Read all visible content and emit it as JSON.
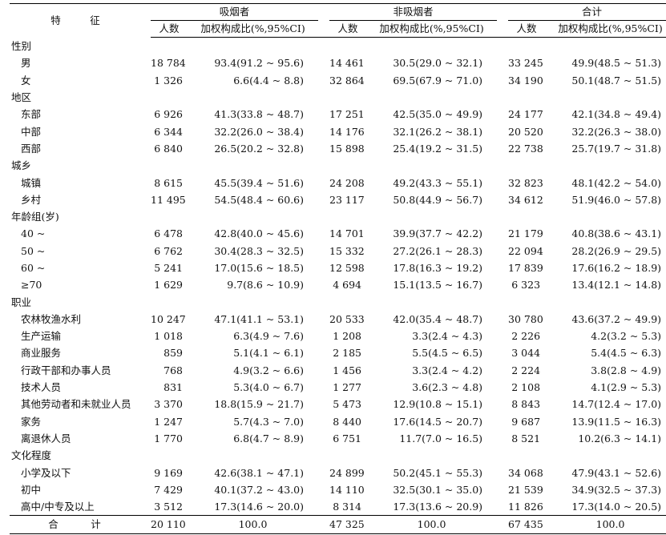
{
  "header": {
    "feature": "特　征",
    "groups": [
      "吸烟者",
      "非吸烟者",
      "合计"
    ],
    "count_label": "人数",
    "pct_label": "加权构成比(%,95%CI)"
  },
  "sections": [
    {
      "name": "性别",
      "rows": [
        {
          "label": "男",
          "s_n": "18 784",
          "s_p": "93.4(91.2 ~ 95.6)",
          "n_n": "14 461",
          "n_p": "30.5(29.0 ~ 32.1)",
          "t_n": "33 245",
          "t_p": "49.9(48.5 ~ 51.3)"
        },
        {
          "label": "女",
          "s_n": "1 326",
          "s_p": "6.6(4.4 ~ 8.8)",
          "n_n": "32 864",
          "n_p": "69.5(67.9 ~ 71.0)",
          "t_n": "34 190",
          "t_p": "50.1(48.7 ~ 51.5)"
        }
      ]
    },
    {
      "name": "地区",
      "rows": [
        {
          "label": "东部",
          "s_n": "6 926",
          "s_p": "41.3(33.8 ~ 48.7)",
          "n_n": "17 251",
          "n_p": "42.5(35.0 ~ 49.9)",
          "t_n": "24 177",
          "t_p": "42.1(34.8 ~ 49.4)"
        },
        {
          "label": "中部",
          "s_n": "6 344",
          "s_p": "32.2(26.0 ~ 38.4)",
          "n_n": "14 176",
          "n_p": "32.1(26.2 ~ 38.1)",
          "t_n": "20 520",
          "t_p": "32.2(26.3 ~ 38.0)"
        },
        {
          "label": "西部",
          "s_n": "6 840",
          "s_p": "26.5(20.2 ~ 32.8)",
          "n_n": "15 898",
          "n_p": "25.4(19.2 ~ 31.5)",
          "t_n": "22 738",
          "t_p": "25.7(19.7 ~ 31.8)"
        }
      ]
    },
    {
      "name": "城乡",
      "rows": [
        {
          "label": "城镇",
          "s_n": "8 615",
          "s_p": "45.5(39.4 ~ 51.6)",
          "n_n": "24 208",
          "n_p": "49.2(43.3 ~ 55.1)",
          "t_n": "32 823",
          "t_p": "48.1(42.2 ~ 54.0)"
        },
        {
          "label": "乡村",
          "s_n": "11 495",
          "s_p": "54.5(48.4 ~ 60.6)",
          "n_n": "23 117",
          "n_p": "50.8(44.9 ~ 56.7)",
          "t_n": "34 612",
          "t_p": "51.9(46.0 ~ 57.8)"
        }
      ]
    },
    {
      "name": "年龄组(岁)",
      "rows": [
        {
          "label": "40 ~",
          "s_n": "6 478",
          "s_p": "42.8(40.0 ~ 45.6)",
          "n_n": "14 701",
          "n_p": "39.9(37.7 ~ 42.2)",
          "t_n": "21 179",
          "t_p": "40.8(38.6 ~ 43.1)"
        },
        {
          "label": "50 ~",
          "s_n": "6 762",
          "s_p": "30.4(28.3 ~ 32.5)",
          "n_n": "15 332",
          "n_p": "27.2(26.1 ~ 28.3)",
          "t_n": "22 094",
          "t_p": "28.2(26.9 ~ 29.5)"
        },
        {
          "label": "60 ~",
          "s_n": "5 241",
          "s_p": "17.0(15.6 ~ 18.5)",
          "n_n": "12 598",
          "n_p": "17.8(16.3 ~ 19.2)",
          "t_n": "17 839",
          "t_p": "17.6(16.2 ~ 18.9)"
        },
        {
          "label": "≥70",
          "s_n": "1 629",
          "s_p": "9.7(8.6 ~ 10.9)",
          "n_n": "4 694",
          "n_p": "15.1(13.5 ~ 16.7)",
          "t_n": "6 323",
          "t_p": "13.4(12.1 ~ 14.8)"
        }
      ]
    },
    {
      "name": "职业",
      "rows": [
        {
          "label": "农林牧渔水利",
          "s_n": "10 247",
          "s_p": "47.1(41.1 ~ 53.1)",
          "n_n": "20 533",
          "n_p": "42.0(35.4 ~ 48.7)",
          "t_n": "30 780",
          "t_p": "43.6(37.2 ~ 49.9)"
        },
        {
          "label": "生产运输",
          "s_n": "1 018",
          "s_p": "6.3(4.9 ~ 7.6)",
          "n_n": "1 208",
          "n_p": "3.3(2.4 ~ 4.3)",
          "t_n": "2 226",
          "t_p": "4.2(3.2 ~ 5.3)"
        },
        {
          "label": "商业服务",
          "s_n": "859",
          "s_p": "5.1(4.1 ~ 6.1)",
          "n_n": "2 185",
          "n_p": "5.5(4.5 ~ 6.5)",
          "t_n": "3 044",
          "t_p": "5.4(4.5 ~ 6.3)"
        },
        {
          "label": "行政干部和办事人员",
          "s_n": "768",
          "s_p": "4.9(3.2 ~ 6.6)",
          "n_n": "1 456",
          "n_p": "3.3(2.4 ~ 4.2)",
          "t_n": "2 224",
          "t_p": "3.8(2.8 ~ 4.9)"
        },
        {
          "label": "技术人员",
          "s_n": "831",
          "s_p": "5.3(4.0 ~ 6.7)",
          "n_n": "1 277",
          "n_p": "3.6(2.3 ~ 4.8)",
          "t_n": "2 108",
          "t_p": "4.1(2.9 ~ 5.3)"
        },
        {
          "label": "其他劳动者和未就业人员",
          "s_n": "3 370",
          "s_p": "18.8(15.9 ~ 21.7)",
          "n_n": "5 473",
          "n_p": "12.9(10.8 ~ 15.1)",
          "t_n": "8 843",
          "t_p": "14.7(12.4 ~ 17.0)"
        },
        {
          "label": "家务",
          "s_n": "1 247",
          "s_p": "5.7(4.3 ~ 7.0)",
          "n_n": "8 440",
          "n_p": "17.6(14.5 ~ 20.7)",
          "t_n": "9 687",
          "t_p": "13.9(11.5 ~ 16.3)"
        },
        {
          "label": "离退休人员",
          "s_n": "1 770",
          "s_p": "6.8(4.7 ~ 8.9)",
          "n_n": "6 751",
          "n_p": "11.7(7.0 ~ 16.5)",
          "t_n": "8 521",
          "t_p": "10.2(6.3 ~ 14.1)"
        }
      ]
    },
    {
      "name": "文化程度",
      "rows": [
        {
          "label": "小学及以下",
          "s_n": "9 169",
          "s_p": "42.6(38.1 ~ 47.1)",
          "n_n": "24 899",
          "n_p": "50.2(45.1 ~ 55.3)",
          "t_n": "34 068",
          "t_p": "47.9(43.1 ~ 52.6)"
        },
        {
          "label": "初中",
          "s_n": "7 429",
          "s_p": "40.1(37.2 ~ 43.0)",
          "n_n": "14 110",
          "n_p": "32.5(30.1 ~ 35.0)",
          "t_n": "21 539",
          "t_p": "34.9(32.5 ~ 37.3)"
        },
        {
          "label": "高中/中专及以上",
          "s_n": "3 512",
          "s_p": "17.3(14.6 ~ 20.0)",
          "n_n": "8 314",
          "n_p": "17.3(13.6 ~ 20.9)",
          "t_n": "11 826",
          "t_p": "17.3(14.0 ~ 20.5)"
        }
      ]
    }
  ],
  "total": {
    "label": "合　计",
    "s_n": "20 110",
    "s_p": "100.0",
    "n_n": "47 325",
    "n_p": "100.0",
    "t_n": "67 435",
    "t_p": "100.0"
  }
}
